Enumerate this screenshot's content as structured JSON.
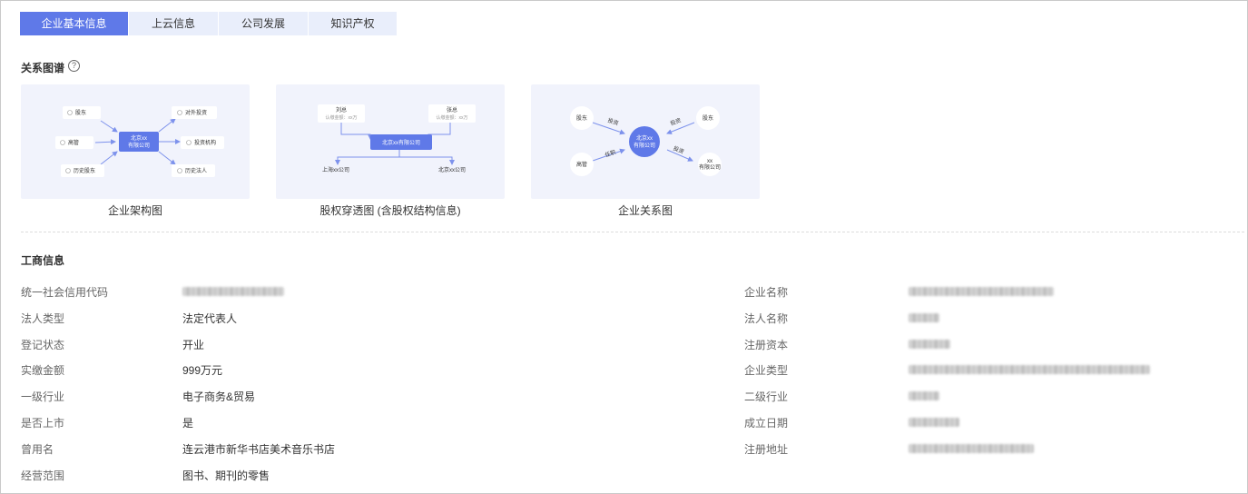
{
  "tabs": [
    {
      "label": "企业基本信息",
      "active": true
    },
    {
      "label": "上云信息",
      "active": false
    },
    {
      "label": "公司发展",
      "active": false
    },
    {
      "label": "知识产权",
      "active": false
    }
  ],
  "relation": {
    "title": "关系图谱",
    "help": "?",
    "cards": [
      {
        "caption": "企业架构图",
        "center_line1": "北京xx",
        "center_line2": "有限公司",
        "nodes": [
          "股东",
          "对外投资",
          "高管",
          "投资机构",
          "历史股东",
          "历史法人"
        ]
      },
      {
        "caption": "股权穿透图 (含股权结构信息)",
        "center": "北京xx有限公司",
        "top_left_name": "刘总",
        "top_left_sub": "认缴金额：xx万",
        "top_right_name": "张总",
        "top_right_sub": "认缴金额：xx万",
        "bottom_left": "上海xx公司",
        "bottom_right": "北京xx公司"
      },
      {
        "caption": "企业关系图",
        "center_line1": "北京xx",
        "center_line2": "有限公司",
        "top_left": "股东",
        "top_right": "股东",
        "bottom_left": "高管",
        "bottom_right_line1": "xx",
        "bottom_right_line2": "有限公司",
        "edge_tl": "投资",
        "edge_tr": "投资",
        "edge_bl": "任职",
        "edge_br": "投资"
      }
    ]
  },
  "business": {
    "title": "工商信息",
    "left": [
      {
        "label": "统一社会信用代码",
        "value": ""
      },
      {
        "label": "法人类型",
        "value": "法定代表人"
      },
      {
        "label": "登记状态",
        "value": "开业"
      },
      {
        "label": "实缴金额",
        "value": "999万元"
      },
      {
        "label": "一级行业",
        "value": "电子商务&贸易"
      },
      {
        "label": "是否上市",
        "value": "是"
      },
      {
        "label": "曾用名",
        "value": "连云港市新华书店美术音乐书店"
      },
      {
        "label": "经营范围",
        "value": "图书、期刊的零售"
      }
    ],
    "right": [
      {
        "label": "企业名称",
        "value": ""
      },
      {
        "label": "法人名称",
        "value": ""
      },
      {
        "label": "注册资本",
        "value": ""
      },
      {
        "label": "企业类型",
        "value": ""
      },
      {
        "label": "二级行业",
        "value": ""
      },
      {
        "label": "成立日期",
        "value": ""
      },
      {
        "label": "注册地址",
        "value": ""
      }
    ]
  },
  "colors": {
    "accent": "#5f79e8",
    "tab_bg": "#e9eefb",
    "card_bg": "#f1f3fc"
  }
}
